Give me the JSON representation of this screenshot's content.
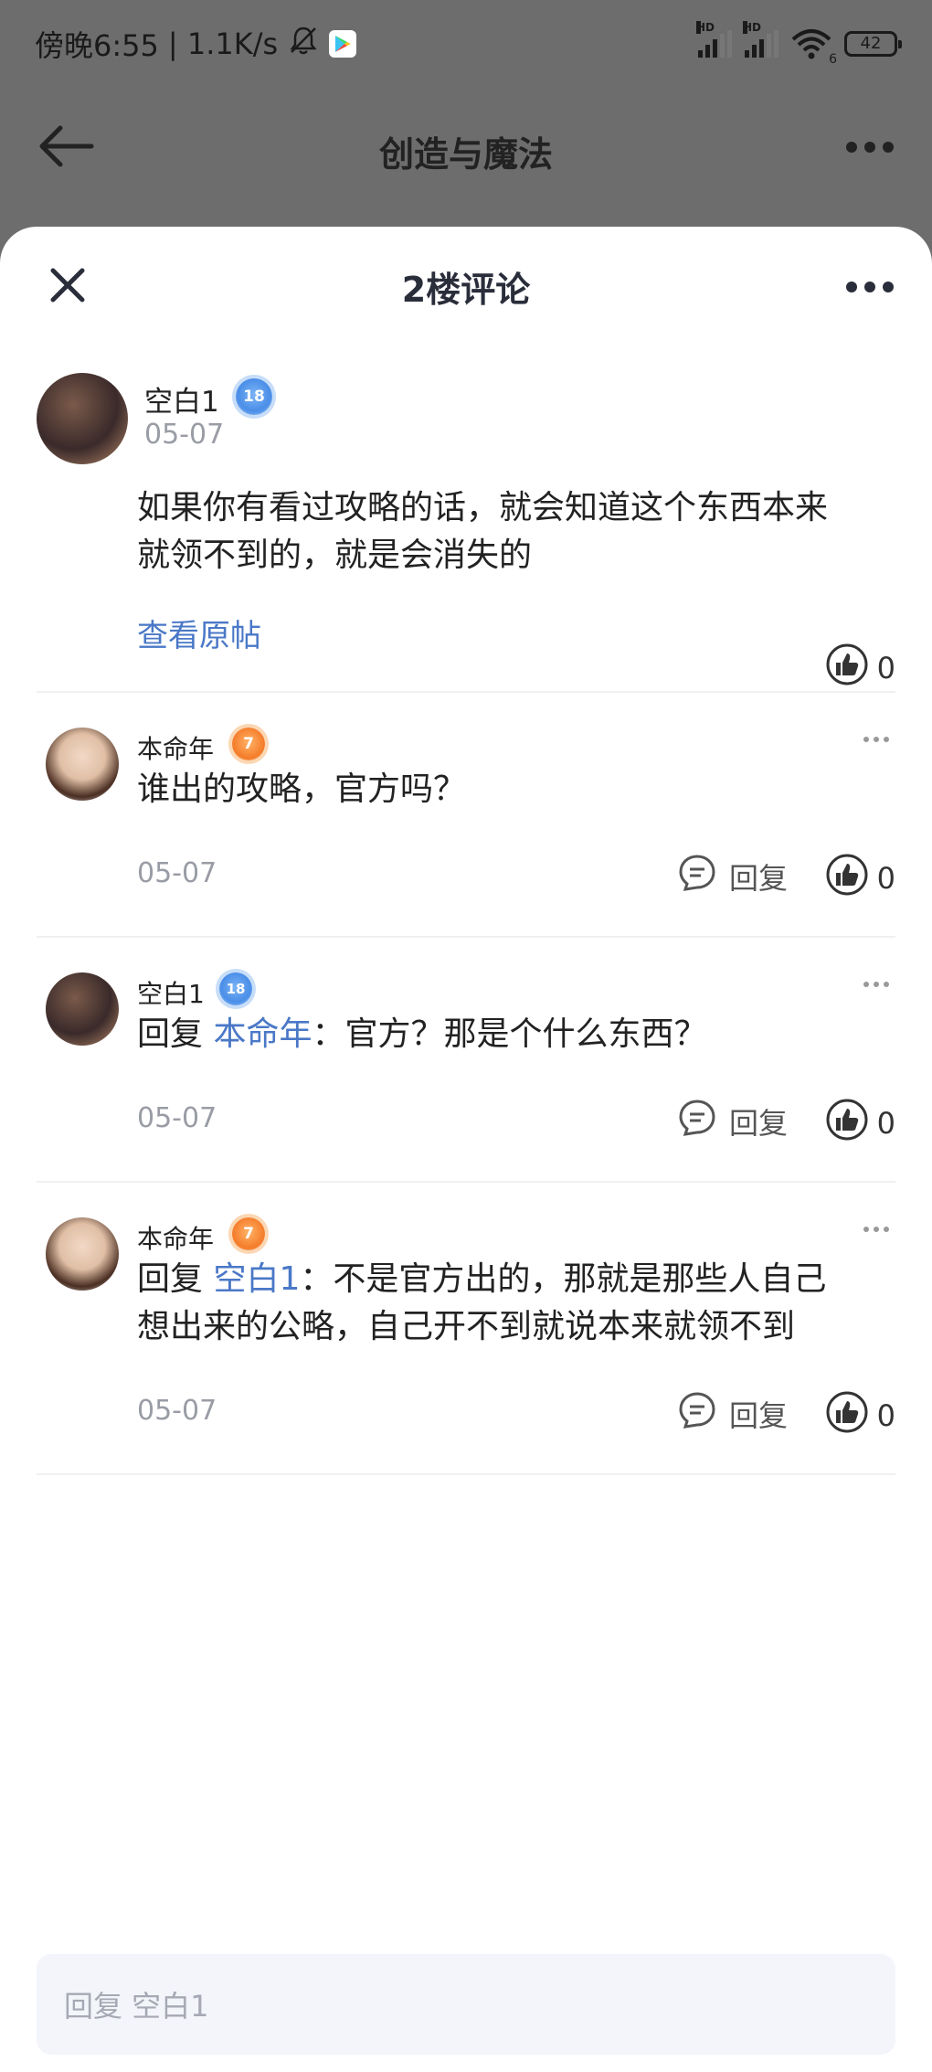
{
  "status_bar": {
    "time": "傍晚6:55",
    "speed": "| 1.1K/s",
    "hd1": "HD",
    "hd2": "HD",
    "wifi_sub": "6",
    "battery": "42"
  },
  "nav": {
    "title": "创造与魔法"
  },
  "sheet": {
    "title": "2楼评论"
  },
  "main_comment": {
    "user": "空白1",
    "level": "18",
    "date": "05-07",
    "text_line1": "如果你有看过攻略的话，就会知道这个东西本来",
    "text_line2": "就领不到的，就是会消失的",
    "view_original": "查看原帖",
    "likes": "0"
  },
  "replies": [
    {
      "user": "本命年",
      "level": "7",
      "reply_prefix": "",
      "reply_to": "",
      "text_line1": "谁出的攻略，官方吗？",
      "text_line2": "",
      "date": "05-07",
      "reply_label": "回复",
      "likes": "0"
    },
    {
      "user": "空白1",
      "level": "18",
      "reply_prefix": "回复 ",
      "reply_to": "本命年",
      "text_line1": "：官方？那是个什么东西？",
      "text_line2": "",
      "date": "05-07",
      "reply_label": "回复",
      "likes": "0"
    },
    {
      "user": "本命年",
      "level": "7",
      "reply_prefix": "回复 ",
      "reply_to": "空白1",
      "text_line1": "：不是官方出的，那就是那些人自己",
      "text_line2": "想出来的公略，自己开不到就说本来就领不到",
      "date": "05-07",
      "reply_label": "回复",
      "likes": "0"
    }
  ],
  "input": {
    "placeholder": "回复 空白1"
  },
  "colors": {
    "link": "#4a78c7",
    "dim_overlay": "#6d6d6d",
    "input_bg": "#f3f5fb"
  },
  "icons": [
    "back-arrow-icon",
    "more-dots-icon",
    "close-icon",
    "thumb-up-icon",
    "reply-bubble-icon",
    "mute-bell-icon",
    "play-store-icon",
    "signal-icon",
    "wifi-icon",
    "battery-icon"
  ]
}
